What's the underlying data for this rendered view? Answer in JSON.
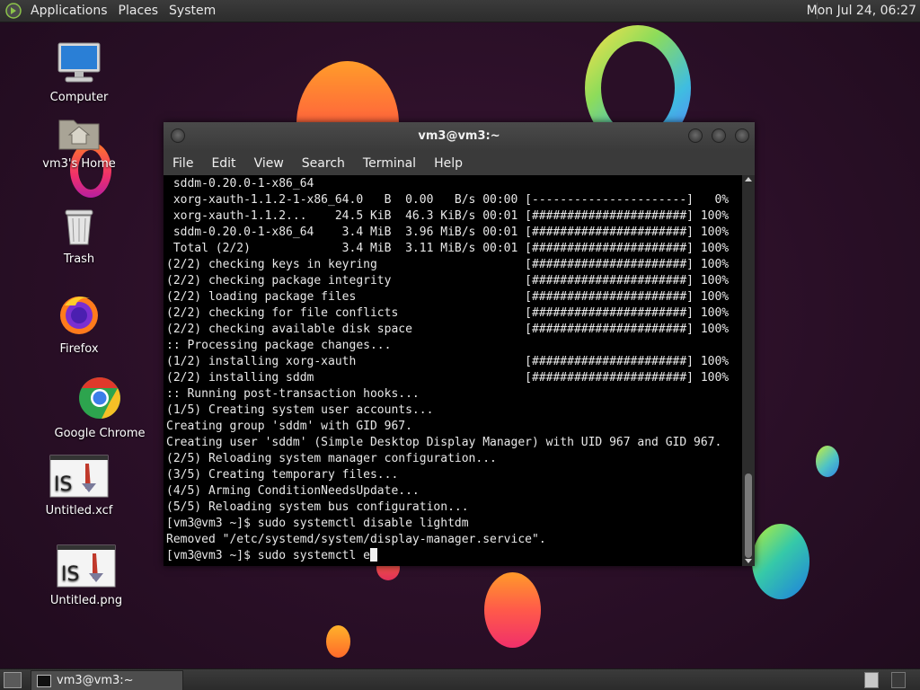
{
  "top_panel": {
    "menus": [
      "Applications",
      "Places",
      "System"
    ],
    "clock": "Mon Jul 24, 06:27"
  },
  "desktop_icons": [
    {
      "label": "Computer",
      "icon": "computer-icon"
    },
    {
      "label": "vm3's Home",
      "icon": "home-folder-icon"
    },
    {
      "label": "Trash",
      "icon": "trash-icon"
    },
    {
      "label": "Firefox",
      "icon": "firefox-icon"
    },
    {
      "label": "Google Chrome",
      "icon": "chrome-icon"
    },
    {
      "label": "Untitled.xcf",
      "icon": "image-file-icon"
    },
    {
      "label": "Untitled.png",
      "icon": "image-file-icon"
    }
  ],
  "window": {
    "title": "vm3@vm3:~",
    "menus": [
      "File",
      "Edit",
      "View",
      "Search",
      "Terminal",
      "Help"
    ]
  },
  "terminal": {
    "lines": [
      " sddm-0.20.0-1-x86_64",
      " xorg-xauth-1.1.2-1-x86_64.0   B  0.00   B/s 00:00 [----------------------]   0%",
      " xorg-xauth-1.1.2...    24.5 KiB  46.3 KiB/s 00:01 [######################] 100%",
      " sddm-0.20.0-1-x86_64    3.4 MiB  3.96 MiB/s 00:01 [######################] 100%",
      " Total (2/2)             3.4 MiB  3.11 MiB/s 00:01 [######################] 100%",
      "(2/2) checking keys in keyring                     [######################] 100%",
      "(2/2) checking package integrity                   [######################] 100%",
      "(2/2) loading package files                        [######################] 100%",
      "(2/2) checking for file conflicts                  [######################] 100%",
      "(2/2) checking available disk space                [######################] 100%",
      ":: Processing package changes...",
      "(1/2) installing xorg-xauth                        [######################] 100%",
      "(2/2) installing sddm                              [######################] 100%",
      ":: Running post-transaction hooks...",
      "(1/5) Creating system user accounts...",
      "Creating group 'sddm' with GID 967.",
      "Creating user 'sddm' (Simple Desktop Display Manager) with UID 967 and GID 967.",
      "(2/5) Reloading system manager configuration...",
      "(3/5) Creating temporary files...",
      "(4/5) Arming ConditionNeedsUpdate...",
      "(5/5) Reloading system bus configuration...",
      "[vm3@vm3 ~]$ sudo systemctl disable lightdm",
      "Removed \"/etc/systemd/system/display-manager.service\"."
    ],
    "prompt_line": "[vm3@vm3 ~]$ sudo systemctl e"
  },
  "taskbar": {
    "task_label": "vm3@vm3:~"
  }
}
